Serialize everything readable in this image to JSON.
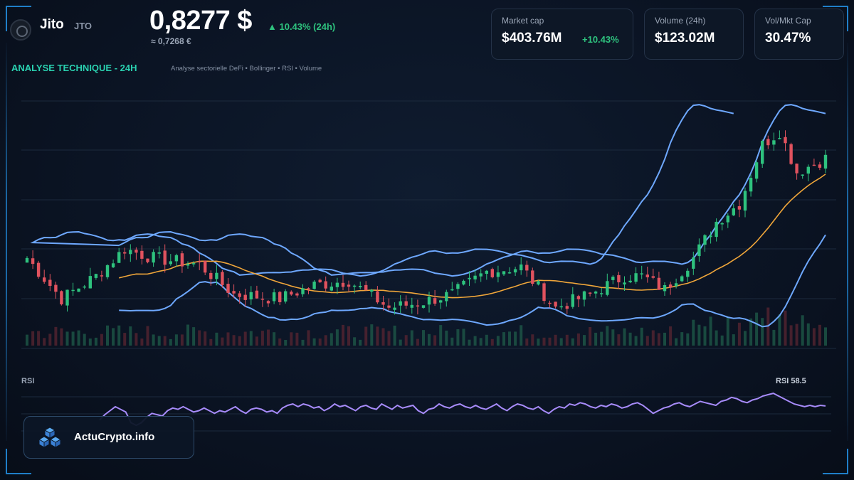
{
  "header": {
    "coin_name": "Jito",
    "ticker": "JTO",
    "price": "0,8277 $",
    "change_24h": "▲ 10.43% (24h)",
    "price_eur": "≈ 0,7268 €",
    "section_title": "ANALYSE TECHNIQUE - 24H",
    "section_subtitle": "Analyse sectorielle DeFi • Bollinger • RSI • Volume"
  },
  "stats": [
    {
      "label": "Market cap",
      "value": "$403.76M",
      "delta": "+10.43%"
    },
    {
      "label": "Volume (24h)",
      "value": "$123.02M",
      "delta": ""
    },
    {
      "label": "Vol/Mkt Cap",
      "value": "30.47%",
      "delta": ""
    }
  ],
  "rsi": {
    "label": "RSI",
    "value_label": "RSI 58.5"
  },
  "brand": {
    "name": "ActuCrypto.info",
    "icon": "cubes-icon"
  },
  "colors": {
    "up": "#2ec27e",
    "down": "#e0525e",
    "bollinger": "#6ea8ff",
    "ma": "#f0a63a",
    "rsi": "#a78bfa",
    "accent": "#2ad1b0"
  },
  "chart_data": {
    "type": "candlestick",
    "grid": true,
    "legend": "none",
    "candle_count": 140,
    "close_anchors": [
      [
        0,
        0.6
      ],
      [
        6,
        0.51
      ],
      [
        12,
        0.56
      ],
      [
        17,
        0.62
      ],
      [
        22,
        0.6
      ],
      [
        30,
        0.585
      ],
      [
        36,
        0.52
      ],
      [
        44,
        0.51
      ],
      [
        50,
        0.54
      ],
      [
        56,
        0.55
      ],
      [
        63,
        0.49
      ],
      [
        68,
        0.5
      ],
      [
        74,
        0.52
      ],
      [
        80,
        0.57
      ],
      [
        86,
        0.58
      ],
      [
        92,
        0.49
      ],
      [
        98,
        0.52
      ],
      [
        104,
        0.56
      ],
      [
        107,
        0.56
      ],
      [
        111,
        0.53
      ],
      [
        116,
        0.6
      ],
      [
        120,
        0.68
      ],
      [
        124,
        0.72
      ],
      [
        128,
        0.85
      ],
      [
        131,
        0.88
      ],
      [
        134,
        0.79
      ],
      [
        139,
        0.82
      ]
    ],
    "volume_range": [
      0,
      1
    ],
    "rsi_values": [
      48,
      52,
      55,
      58,
      56,
      54,
      46,
      44,
      46,
      50,
      53,
      52,
      51,
      55,
      57,
      56,
      58,
      56,
      54,
      55,
      57,
      55,
      53,
      55,
      54,
      56,
      58,
      55,
      53,
      56,
      57,
      56,
      54,
      55,
      53,
      57,
      59,
      60,
      58,
      60,
      59,
      57,
      58,
      55,
      57,
      60,
      58,
      59,
      57,
      55,
      58,
      59,
      57,
      56,
      60,
      58,
      56,
      59,
      57,
      58,
      59,
      55,
      53,
      56,
      57,
      60,
      58,
      57,
      59,
      60,
      58,
      57,
      59,
      57,
      56,
      58,
      60,
      57,
      55,
      58,
      60,
      59,
      57,
      56,
      58,
      55,
      53,
      56,
      58,
      57,
      60,
      59,
      61,
      60,
      58,
      57,
      59,
      58,
      60,
      59,
      57,
      58,
      60,
      61,
      59,
      56,
      53,
      55,
      57,
      58,
      60,
      61,
      59,
      58,
      60,
      62,
      61,
      60,
      59,
      62,
      63,
      65,
      64,
      62,
      61,
      63,
      64,
      66,
      67,
      68,
      66,
      64,
      62,
      60,
      59,
      58,
      59,
      58,
      59,
      58.5
    ]
  }
}
